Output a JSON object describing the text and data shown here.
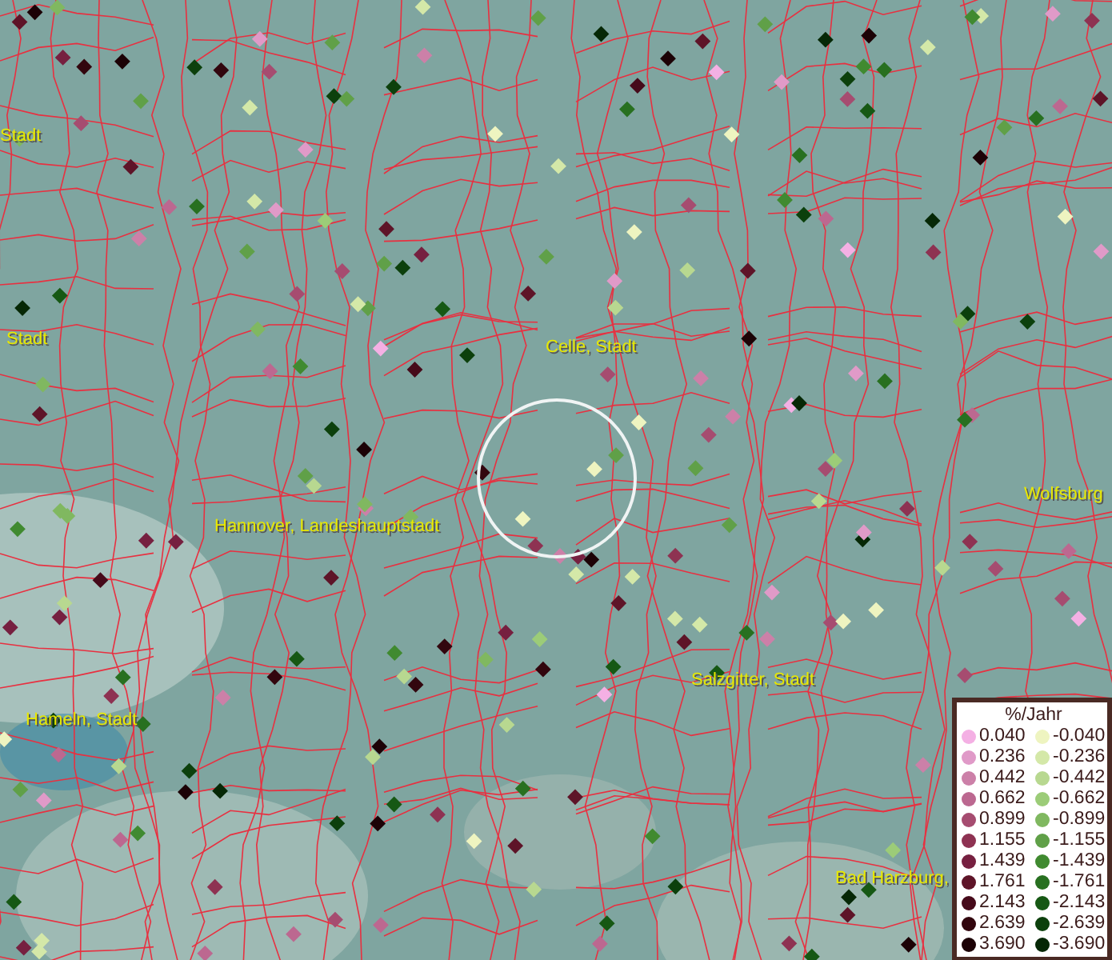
{
  "map": {
    "place_labels": [
      {
        "text": "Stadt"
      },
      {
        "text": "Stadt"
      },
      {
        "text": "Celle, Stadt"
      },
      {
        "text": "Hannover, Landeshauptstadt"
      },
      {
        "text": "Wolfsburg"
      },
      {
        "text": "Hameln, Stadt"
      },
      {
        "text": "Salzgitter, Stadt"
      },
      {
        "text": "Bad Harzburg,"
      }
    ]
  },
  "legend": {
    "title": "%/Jahr",
    "positive": [
      {
        "label": "0.040",
        "color": "#f4b0e4"
      },
      {
        "label": "0.236",
        "color": "#e09ac8"
      },
      {
        "label": "0.442",
        "color": "#cc80a8"
      },
      {
        "label": "0.662",
        "color": "#bc6890"
      },
      {
        "label": "0.899",
        "color": "#a64c70"
      },
      {
        "label": "1.155",
        "color": "#8e3252"
      },
      {
        "label": "1.439",
        "color": "#762040"
      },
      {
        "label": "1.761",
        "color": "#5e1428"
      },
      {
        "label": "2.143",
        "color": "#460a1a"
      },
      {
        "label": "2.639",
        "color": "#32060e"
      },
      {
        "label": "3.690",
        "color": "#1c0206"
      }
    ],
    "negative": [
      {
        "label": "-0.040",
        "color": "#eef4c0"
      },
      {
        "label": "-0.236",
        "color": "#d4e8a8"
      },
      {
        "label": "-0.442",
        "color": "#b8d890"
      },
      {
        "label": "-0.662",
        "color": "#9ccc78"
      },
      {
        "label": "-0.899",
        "color": "#80b860"
      },
      {
        "label": "-1.155",
        "color": "#60a048"
      },
      {
        "label": "-1.439",
        "color": "#408a30"
      },
      {
        "label": "-1.761",
        "color": "#287020"
      },
      {
        "label": "-2.143",
        "color": "#165814"
      },
      {
        "label": "-2.639",
        "color": "#0c400c"
      },
      {
        "label": "-3.690",
        "color": "#062806"
      }
    ]
  }
}
